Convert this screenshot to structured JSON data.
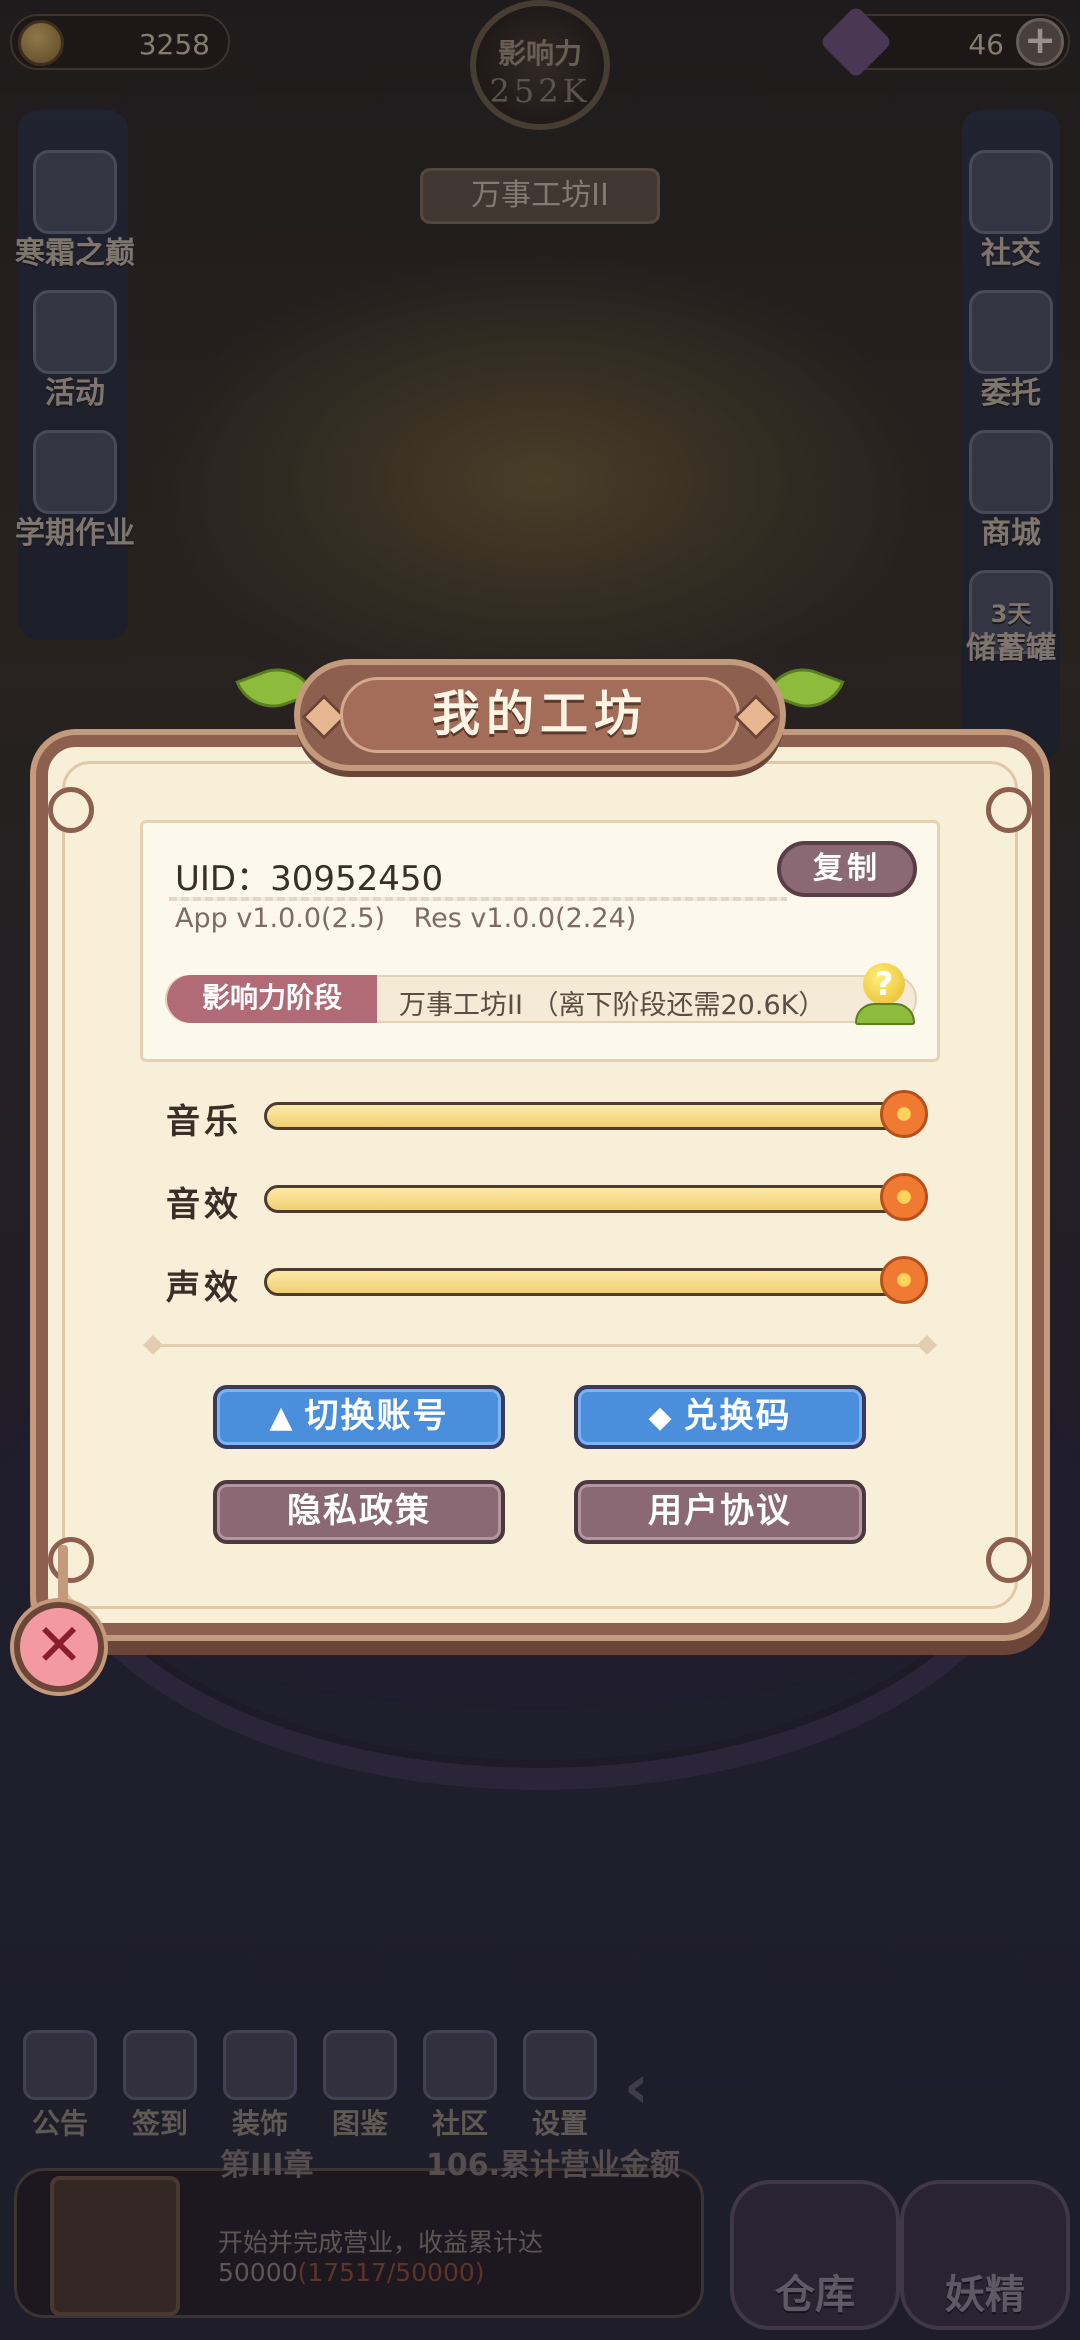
{
  "topbar": {
    "coins": "3258",
    "gems": "46",
    "plus_label": "+",
    "influence_label": "影响力",
    "influence_value": "252K",
    "influence_title": "万事工坊II"
  },
  "left_menu": [
    {
      "label": "寒霜之巅",
      "icon": "frost-peak-icon"
    },
    {
      "label": "活动",
      "icon": "event-icon"
    },
    {
      "label": "学期作业",
      "icon": "homework-icon"
    }
  ],
  "right_menu": [
    {
      "label": "社交",
      "icon": "social-icon"
    },
    {
      "label": "委托",
      "icon": "commission-icon"
    },
    {
      "label": "商城",
      "icon": "shop-icon"
    },
    {
      "label": "储蓄罐",
      "badge": "3天",
      "icon": "piggy-bank-icon"
    }
  ],
  "dialog": {
    "title": "我的工坊",
    "uid": "UID：30952450",
    "copy_label": "复制",
    "app_version": "App v1.0.0(2.5)",
    "res_version": "Res v1.0.0(2.24)",
    "stage_tag": "影响力阶段",
    "stage_text": "万事工坊II （离下阶段还需20.6K）",
    "hint_label": "?",
    "sliders": [
      {
        "label": "音乐",
        "value": 1.0
      },
      {
        "label": "音效",
        "value": 1.0
      },
      {
        "label": "声效",
        "value": 1.0
      }
    ],
    "buttons": {
      "switch_account": "切换账号",
      "redeem_code": "兑换码",
      "privacy_policy": "隐私政策",
      "user_agreement": "用户协议"
    },
    "close_label": "✕"
  },
  "bottom_nav": [
    {
      "label": "公告",
      "icon": "notice-icon"
    },
    {
      "label": "签到",
      "icon": "checkin-icon"
    },
    {
      "label": "装饰",
      "icon": "decor-icon"
    },
    {
      "label": "图鉴",
      "icon": "codex-icon"
    },
    {
      "label": "社区",
      "icon": "community-icon"
    },
    {
      "label": "设置",
      "icon": "settings-icon"
    }
  ],
  "back_label": "‹",
  "quest": {
    "chapter": "第III章",
    "title": "106.累计营业金额",
    "desc": "开始并完成营业，收益累计达50000",
    "progress": "(17517/50000)"
  },
  "big_buttons": {
    "warehouse": "仓库",
    "fairy": "妖精"
  },
  "colors": {
    "dialog_bg": "#f8efd8",
    "frame": "#8d5f4f",
    "blue_button": "#4b8fdc",
    "mauve_button": "#8a6874",
    "stage_tag": "#b16b76"
  }
}
